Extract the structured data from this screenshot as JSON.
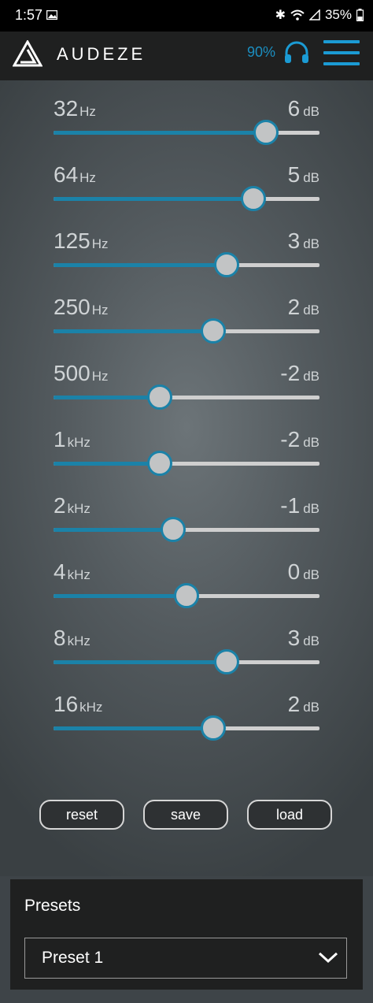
{
  "status_bar": {
    "time": "1:57",
    "battery": "35%"
  },
  "header": {
    "brand": "AUDEZE",
    "headphone_battery": "90%",
    "accent_color": "#1b9bd4"
  },
  "eq": {
    "gain_min": -10,
    "gain_max": 10,
    "bands": [
      {
        "freq": "32",
        "unit": "Hz",
        "gain": "6",
        "gain_unit": "dB",
        "value": 6
      },
      {
        "freq": "64",
        "unit": "Hz",
        "gain": "5",
        "gain_unit": "dB",
        "value": 5
      },
      {
        "freq": "125",
        "unit": "Hz",
        "gain": "3",
        "gain_unit": "dB",
        "value": 3
      },
      {
        "freq": "250",
        "unit": "Hz",
        "gain": "2",
        "gain_unit": "dB",
        "value": 2
      },
      {
        "freq": "500",
        "unit": "Hz",
        "gain": "-2",
        "gain_unit": "dB",
        "value": -2
      },
      {
        "freq": "1",
        "unit": "kHz",
        "gain": "-2",
        "gain_unit": "dB",
        "value": -2
      },
      {
        "freq": "2",
        "unit": "kHz",
        "gain": "-1",
        "gain_unit": "dB",
        "value": -1
      },
      {
        "freq": "4",
        "unit": "kHz",
        "gain": "0",
        "gain_unit": "dB",
        "value": 0
      },
      {
        "freq": "8",
        "unit": "kHz",
        "gain": "3",
        "gain_unit": "dB",
        "value": 3
      },
      {
        "freq": "16",
        "unit": "kHz",
        "gain": "2",
        "gain_unit": "dB",
        "value": 2
      }
    ]
  },
  "actions": {
    "reset": "reset",
    "save": "save",
    "load": "load"
  },
  "presets": {
    "title": "Presets",
    "selected": "Preset 1"
  }
}
